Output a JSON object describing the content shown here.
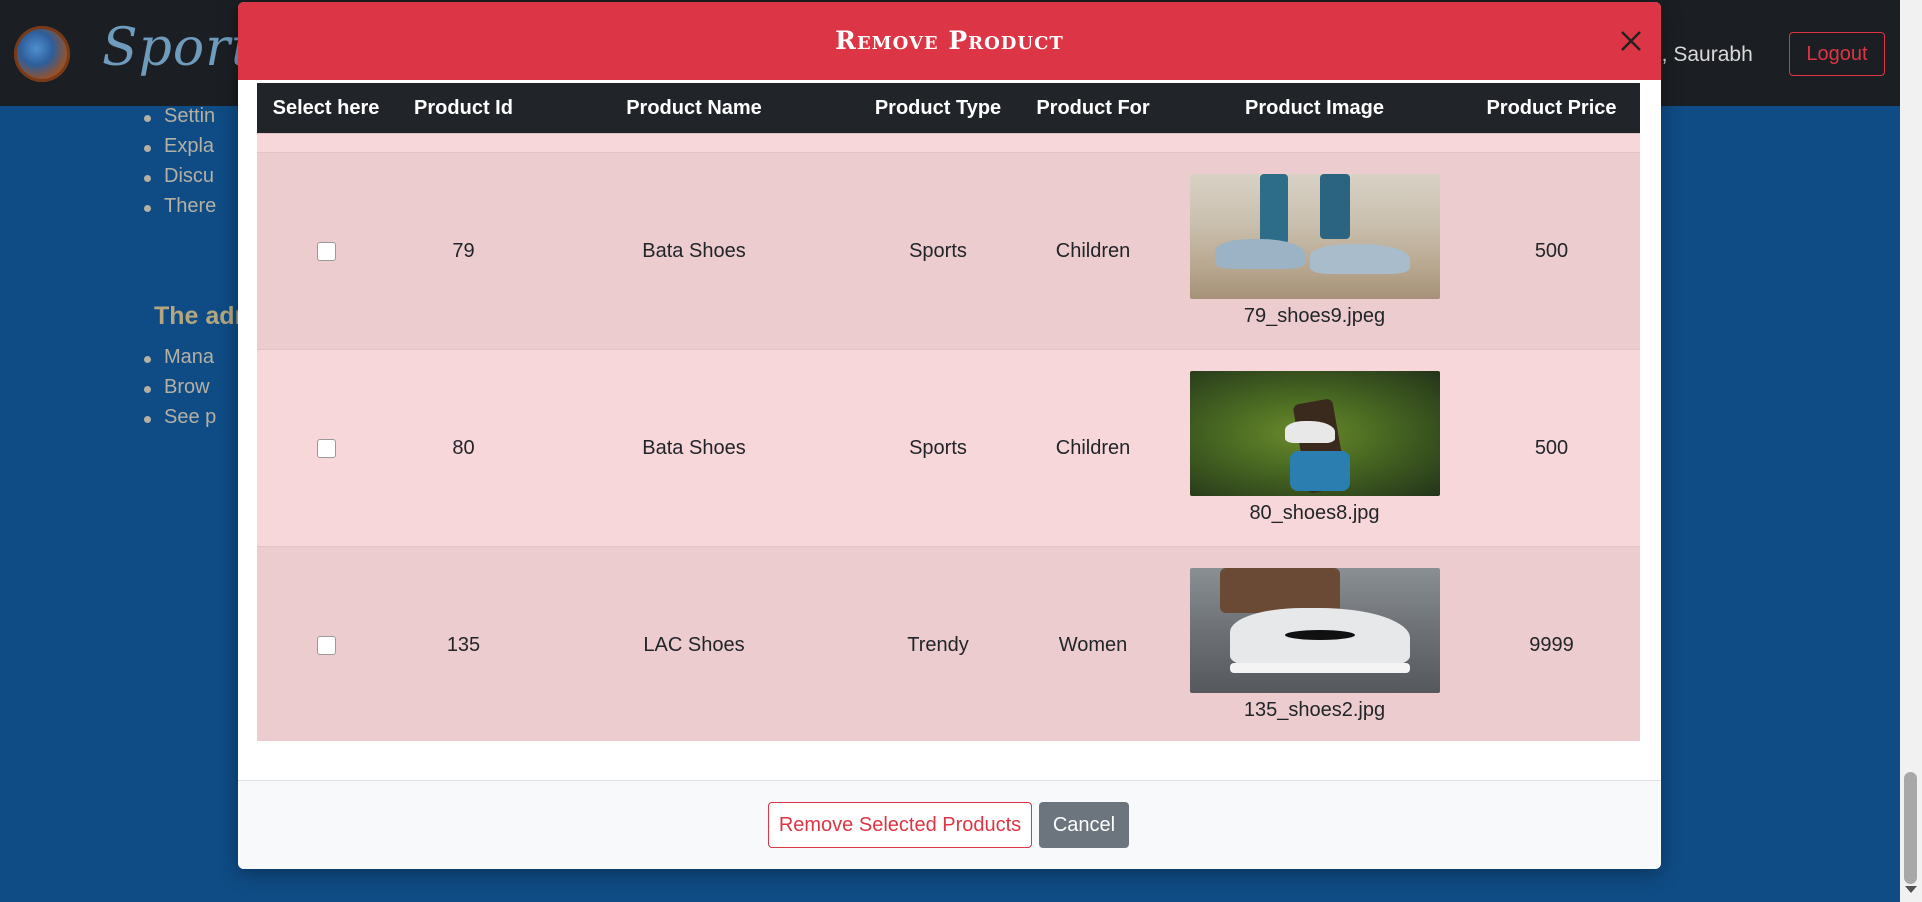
{
  "background": {
    "brand": "Sporty",
    "greeting": "o, Saurabh",
    "logout_label": "Logout",
    "list_top": [
      "Settin",
      "Expla",
      "Discu",
      "There"
    ],
    "admin_heading": "The adr",
    "list_bottom": [
      "Mana",
      "Brow",
      "See p"
    ]
  },
  "modal": {
    "title": "Remove Product",
    "close_icon": "close-icon",
    "columns": [
      "Select here",
      "Product Id",
      "Product Name",
      "Product Type",
      "Product For",
      "Product Image",
      "Product Price"
    ],
    "rows": [
      {
        "id": "79",
        "name": "Bata Shoes",
        "type": "Sports",
        "for": "Children",
        "image": "79_shoes9.jpeg",
        "price": "500",
        "selected": false
      },
      {
        "id": "80",
        "name": "Bata Shoes",
        "type": "Sports",
        "for": "Children",
        "image": "80_shoes8.jpg",
        "price": "500",
        "selected": false
      },
      {
        "id": "135",
        "name": "LAC Shoes",
        "type": "Trendy",
        "for": "Women",
        "image": "135_shoes2.jpg",
        "price": "9999",
        "selected": false
      }
    ],
    "remove_label": "Remove Selected Products",
    "cancel_label": "Cancel"
  },
  "colors": {
    "header_red": "#dc3545",
    "table_head": "#212529",
    "row_odd": "#eccccf",
    "row_even": "#f8d7da",
    "page_bg": "#0f4c85"
  }
}
